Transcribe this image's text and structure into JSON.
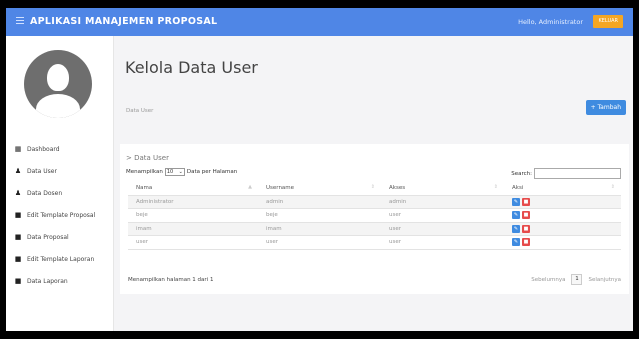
{
  "header": {
    "title": "APLIKASI MANAJEMEN PROPOSAL",
    "greeting": "Hello, Administrator",
    "logout_label": "KELUAR"
  },
  "sidebar": {
    "items": [
      {
        "label": "Dashboard",
        "icon": "dashboard-icon"
      },
      {
        "label": "Data User",
        "icon": "user-icon"
      },
      {
        "label": "Data Dosen",
        "icon": "user-icon"
      },
      {
        "label": "Edit Template Proposal",
        "icon": "file-icon"
      },
      {
        "label": "Data Proposal",
        "icon": "file-icon"
      },
      {
        "label": "Edit Template Laporan",
        "icon": "file-icon"
      },
      {
        "label": "Data Laporan",
        "icon": "file-icon"
      }
    ]
  },
  "main": {
    "title": "Kelola Data User",
    "breadcrumb": "Data User",
    "add_label": "+ Tambah",
    "panel_title": "> Data User",
    "length": {
      "prefix": "Menampilkan",
      "value": "10",
      "suffix": "Data per Halaman"
    },
    "search_label": "Search:",
    "table": {
      "headers": [
        "Nama",
        "Username",
        "Akses",
        "Aksi"
      ],
      "rows": [
        [
          "Administrator",
          "admin",
          "admin"
        ],
        [
          "beje",
          "beje",
          "user"
        ],
        [
          "imam",
          "imam",
          "user"
        ],
        [
          "user",
          "user",
          "user"
        ]
      ]
    },
    "info": "Menampilkan halaman 1 dari 1",
    "pager": {
      "prev": "Sebelumnya",
      "current": "1",
      "next": "Selanjutnya"
    }
  },
  "colors": {
    "topbar": "#4f86e6",
    "logout": "#f5a623",
    "edit": "#3f8be0",
    "delete": "#e64b4b"
  }
}
